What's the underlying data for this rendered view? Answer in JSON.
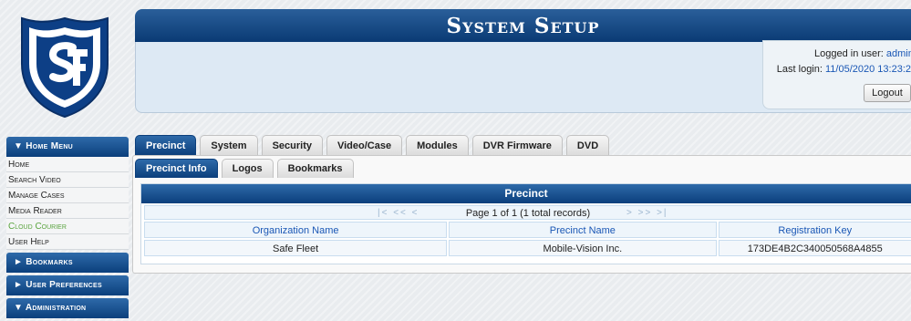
{
  "header": {
    "title": "System Setup"
  },
  "login": {
    "user_label": "Logged in user:",
    "user_value": "admin",
    "last_label": "Last login:",
    "last_value": "11/05/2020 13:23:2",
    "logout_label": "Logout"
  },
  "sidebar": {
    "home_menu": "▼ Home Menu",
    "items": [
      "Home",
      "Search Video",
      "Manage Cases",
      "Media Reader",
      "Cloud Courier",
      "User Help"
    ],
    "bookmarks": "► Bookmarks",
    "user_prefs": "► User Preferences",
    "administration": "▼ Administration"
  },
  "tabs": [
    "Precinct",
    "System",
    "Security",
    "Video/Case",
    "Modules",
    "DVR Firmware",
    "DVD"
  ],
  "subtabs": [
    "Precinct Info",
    "Logos",
    "Bookmarks"
  ],
  "grid": {
    "title": "Precinct",
    "pager_text": "Page 1 of 1 (1 total records)",
    "pager_prev": "|< << <",
    "pager_next": "> >> >|",
    "columns": [
      "Organization Name",
      "Precinct Name",
      "Registration Key"
    ],
    "rows": [
      [
        "Safe Fleet",
        "Mobile-Vision Inc.",
        "173DE4B2C340050568A4855"
      ]
    ]
  },
  "colors": {
    "accent": "#0b3f7c",
    "link": "#1a57b5",
    "cloud_courier": "#5aa43f"
  }
}
